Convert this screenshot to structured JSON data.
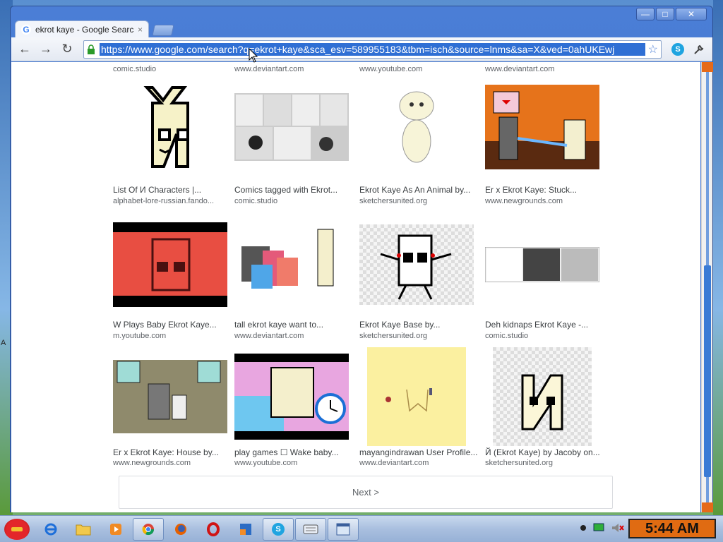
{
  "window": {
    "tab_title": "ekrot kaye - Google Search",
    "tab_close": "×",
    "controls": {
      "minimize": "—",
      "maximize": "□",
      "close": "✕"
    }
  },
  "toolbar": {
    "back": "←",
    "forward": "→",
    "reload": "↻",
    "url": "https://www.google.com/search?q=ekrot+kaye&sca_esv=589955183&tbm=isch&source=lnms&sa=X&ved=0ahUKEwj",
    "star": "☆",
    "skype": "S",
    "wrench": "🔧"
  },
  "top_sources": [
    "comic.studio",
    "www.deviantart.com",
    "www.youtube.com",
    "www.deviantart.com"
  ],
  "results": [
    {
      "caption": "List Of И Characters |...",
      "source": "alphabet-lore-russian.fando..."
    },
    {
      "caption": "Comics tagged with Ekrot...",
      "source": "comic.studio"
    },
    {
      "caption": "Ekrot Kaye As An Animal by...",
      "source": "sketchersunited.org"
    },
    {
      "caption": "Er x Ekrot Kaye: Stuck...",
      "source": "www.newgrounds.com"
    },
    {
      "caption": "W Plays Baby Ekrot Kaye...",
      "source": "m.youtube.com"
    },
    {
      "caption": "tall ekrot kaye want to...",
      "source": "www.deviantart.com"
    },
    {
      "caption": "Ekrot Kaye Base by...",
      "source": "sketchersunited.org"
    },
    {
      "caption": "Deh kidnaps Ekrot Kaye -...",
      "source": "comic.studio"
    },
    {
      "caption": "Er x Ekrot Kaye: House by...",
      "source": "www.newgrounds.com"
    },
    {
      "caption": "play games ☐ Wake baby...",
      "source": "www.youtube.com"
    },
    {
      "caption": "mayangindrawan User Profile...",
      "source": "www.deviantart.com"
    },
    {
      "caption": "Й (Ekrot Kaye) by Jacoby on...",
      "source": "sketchersunited.org"
    }
  ],
  "next_label": "Next >",
  "desktop_letter": "A",
  "taskbar": {
    "clock": "5:44 AM"
  },
  "colors": {
    "url_highlight": "#2f6fd4",
    "clock_bg": "#e06b12",
    "scroll_accent": "#3a7bd5"
  }
}
